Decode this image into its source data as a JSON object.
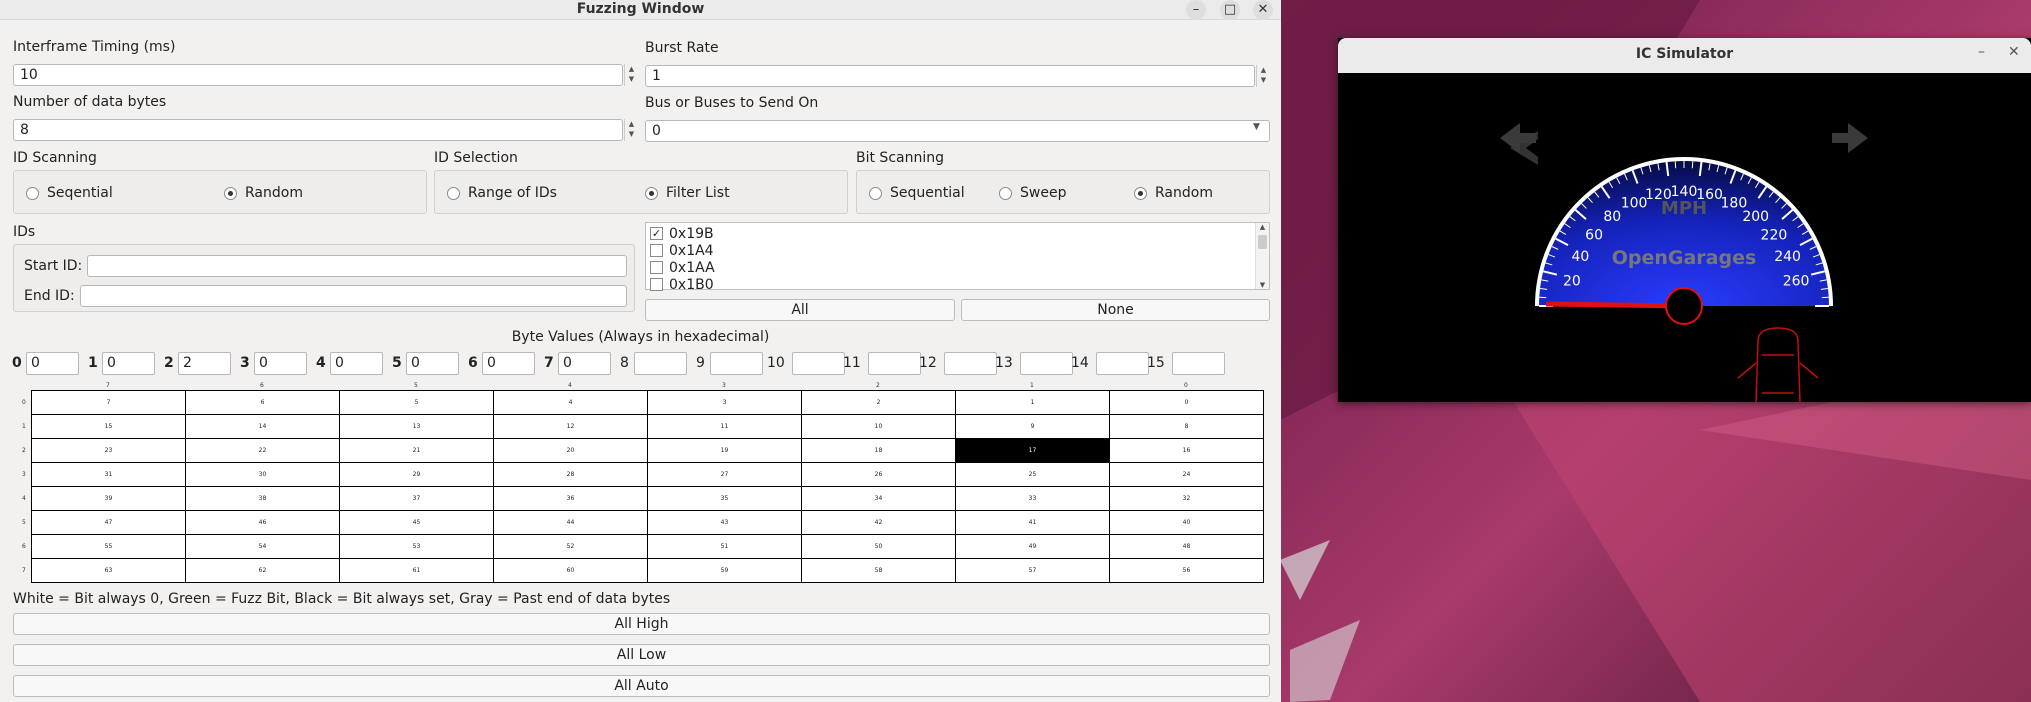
{
  "fuzz": {
    "title": "Fuzzing Window",
    "interframe_label": "Interframe Timing (ms)",
    "interframe_value": "10",
    "burst_label": "Burst Rate",
    "burst_value": "1",
    "databytes_label": "Number of data bytes",
    "databytes_value": "8",
    "bus_label": "Bus or Buses to Send On",
    "bus_value": "0",
    "id_scanning_label": "ID Scanning",
    "id_scanning_opts": [
      "Seqential",
      "Random"
    ],
    "id_selection_label": "ID Selection",
    "id_selection_opts": [
      "Range of IDs",
      "Filter List"
    ],
    "bit_scanning_label": "Bit Scanning",
    "bit_scanning_opts": [
      "Sequential",
      "Sweep",
      "Random"
    ],
    "ids_label": "IDs",
    "start_id_label": "Start ID:",
    "end_id_label": "End ID:",
    "id_list": [
      {
        "label": "0x19B",
        "checked": true
      },
      {
        "label": "0x1A4",
        "checked": false
      },
      {
        "label": "0x1AA",
        "checked": false
      },
      {
        "label": "0x1B0",
        "checked": false
      }
    ],
    "all_label": "All",
    "none_label": "None",
    "byte_values_label": "Byte Values (Always in hexadecimal)",
    "byte_indices": [
      "0",
      "1",
      "2",
      "3",
      "4",
      "5",
      "6",
      "7",
      "8",
      "9",
      "10",
      "11",
      "12",
      "13",
      "14",
      "15"
    ],
    "byte_values": [
      "0",
      "0",
      "2",
      "0",
      "0",
      "0",
      "0",
      "0",
      "",
      "",
      "",
      "",
      "",
      "",
      "",
      ""
    ],
    "grid_col_labels": [
      "7",
      "6",
      "5",
      "4",
      "3",
      "2",
      "1",
      "0"
    ],
    "grid_row_labels": [
      "0",
      "1",
      "2",
      "3",
      "4",
      "5",
      "6",
      "7"
    ],
    "grid": [
      [
        "7",
        "6",
        "5",
        "4",
        "3",
        "2",
        "1",
        "0"
      ],
      [
        "15",
        "14",
        "13",
        "12",
        "11",
        "10",
        "9",
        "8"
      ],
      [
        "23",
        "22",
        "21",
        "20",
        "19",
        "18",
        "17",
        "16"
      ],
      [
        "31",
        "30",
        "29",
        "28",
        "27",
        "26",
        "25",
        "24"
      ],
      [
        "39",
        "38",
        "37",
        "36",
        "35",
        "34",
        "33",
        "32"
      ],
      [
        "47",
        "46",
        "45",
        "44",
        "43",
        "42",
        "41",
        "40"
      ],
      [
        "55",
        "54",
        "53",
        "52",
        "51",
        "50",
        "49",
        "48"
      ],
      [
        "63",
        "62",
        "61",
        "60",
        "59",
        "58",
        "57",
        "56"
      ]
    ],
    "set_bits": [
      "17"
    ],
    "legend": "White = Bit always 0, Green = Fuzz Bit, Black = Bit always set, Gray = Past end of data bytes",
    "all_high": "All High",
    "all_low": "All Low",
    "all_auto": "All Auto"
  },
  "ic": {
    "title": "IC Simulator",
    "mph": "MPH",
    "brand": "OpenGarages",
    "speeds": [
      "20",
      "40",
      "60",
      "80",
      "100",
      "120",
      "140",
      "160",
      "180",
      "200",
      "220",
      "240",
      "260"
    ]
  },
  "colors": {
    "accent_blue": "#1a2fd6",
    "needle_red": "#e01010"
  }
}
